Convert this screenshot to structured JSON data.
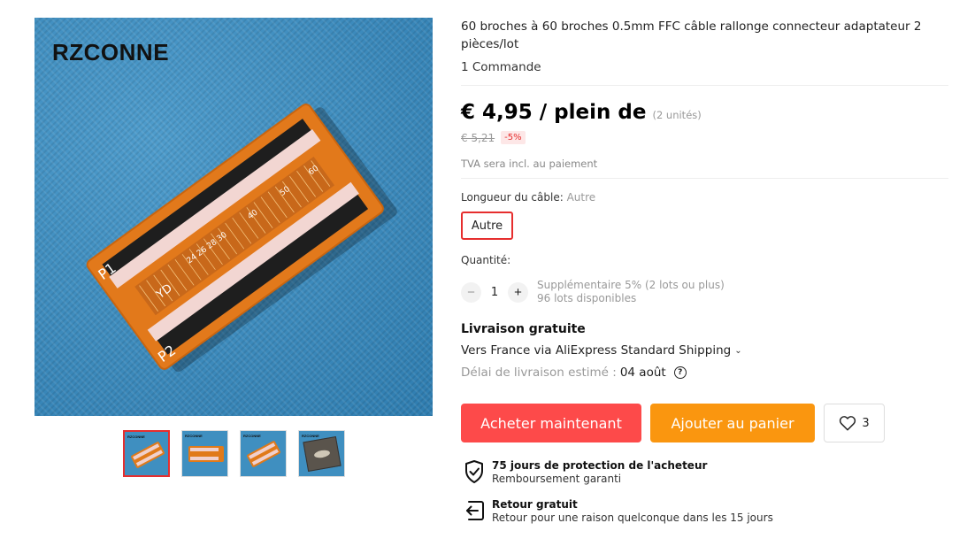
{
  "gallery": {
    "watermark": "RZCONNE",
    "board_labels": [
      "P1",
      "P2",
      "YD",
      "24",
      "26",
      "28",
      "30",
      "40",
      "50",
      "60"
    ],
    "thumbnails": [
      {
        "watermark": "RZCONNE",
        "kind": "board-angled",
        "active": true
      },
      {
        "watermark": "RZCONNE",
        "kind": "board-flat",
        "active": false
      },
      {
        "watermark": "RZCONNE",
        "kind": "board-angled",
        "active": false
      },
      {
        "watermark": "RZCONNE",
        "kind": "box",
        "active": false
      }
    ]
  },
  "product": {
    "title": "60 broches à 60 broches 0.5mm FFC câble rallonge connecteur adaptateur 2 pièces/lot",
    "orders": "1 Commande"
  },
  "pricing": {
    "price": "€ 4,95 / plein de",
    "units": "(2 unités)",
    "old_price": "€ 5,21",
    "discount": "-5%",
    "vat_note": "TVA sera incl. au paiement"
  },
  "options": {
    "cable_label": "Longueur du câble:",
    "cable_value": "Autre",
    "selected_option": "Autre"
  },
  "quantity": {
    "label": "Quantité:",
    "value": "1",
    "minus": "−",
    "plus": "+",
    "note_line1": "Supplémentaire 5% (2 lots ou plus)",
    "note_line2": "96 lots disponibles"
  },
  "shipping": {
    "title": "Livraison gratuite",
    "via": "Vers France via AliExpress Standard Shipping",
    "delay_label": "Délai de livraison estimé :",
    "delay_date": "04 août",
    "help_glyph": "?"
  },
  "actions": {
    "buy_now": "Acheter maintenant",
    "add_to_cart": "Ajouter au panier",
    "wishlist_count": "3",
    "buy_color": "#fd4a4a",
    "cart_color": "#fa960f"
  },
  "guarantees": [
    {
      "icon": "shield-check-icon",
      "title": "75 jours de protection de l'acheteur",
      "subtitle": "Remboursement garanti"
    },
    {
      "icon": "return-icon",
      "title": "Retour gratuit",
      "subtitle": "Retour pour une raison quelconque dans les 15 jours"
    }
  ]
}
